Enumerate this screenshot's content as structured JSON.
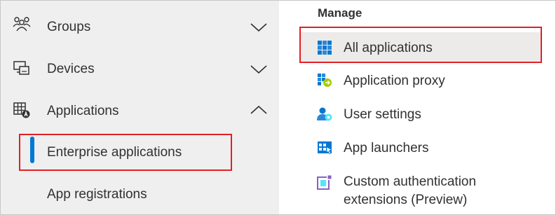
{
  "left_nav": {
    "items": [
      {
        "label": "Groups",
        "icon": "groups-icon",
        "expanded": false
      },
      {
        "label": "Devices",
        "icon": "devices-icon",
        "expanded": false
      },
      {
        "label": "Applications",
        "icon": "applications-icon",
        "expanded": true
      }
    ],
    "sub_items": [
      {
        "label": "Enterprise applications",
        "selected": true
      },
      {
        "label": "App registrations",
        "selected": false
      }
    ]
  },
  "right_panel": {
    "section_heading": "Manage",
    "items": [
      {
        "label": "All applications",
        "icon": "all-applications-icon",
        "active": true
      },
      {
        "label": "Application proxy",
        "icon": "application-proxy-icon",
        "active": false
      },
      {
        "label": "User settings",
        "icon": "user-settings-icon",
        "active": false
      },
      {
        "label": "App launchers",
        "icon": "app-launchers-icon",
        "active": false
      },
      {
        "label": "Custom authentication extensions (Preview)",
        "icon": "custom-authentication-extensions-icon",
        "active": false
      }
    ],
    "custom_auth_line1": "Custom authentication",
    "custom_auth_line2": "extensions (Preview)"
  },
  "colors": {
    "accent": "#0078d4",
    "highlight_border": "#e31f26",
    "nav_background": "#efefef",
    "active_item_background": "#edebe9"
  }
}
